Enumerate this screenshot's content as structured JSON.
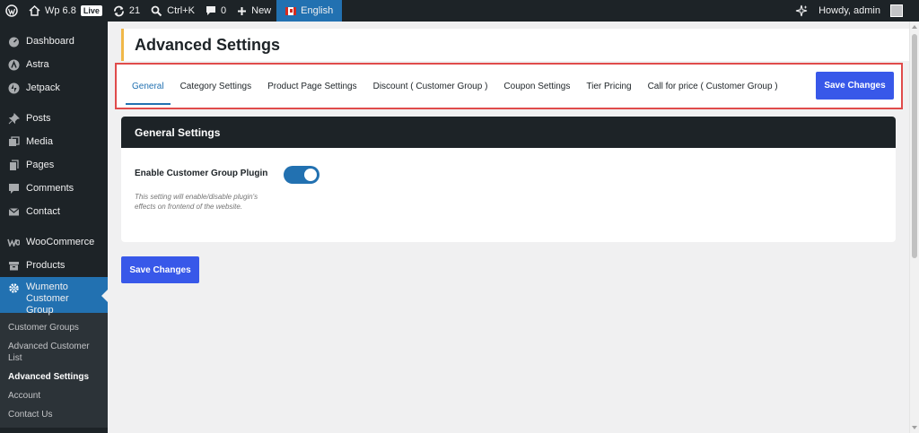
{
  "adminbar": {
    "site_name": "Wp 6.8",
    "live_label": "Live",
    "updates_count": "21",
    "search_shortcut": "Ctrl+K",
    "comments_count": "0",
    "new_label": "New",
    "language": "English",
    "greeting": "Howdy, admin"
  },
  "sidebar": {
    "items": [
      {
        "label": "Dashboard",
        "icon": "dashboard-icon"
      },
      {
        "label": "Astra",
        "icon": "astra-icon"
      },
      {
        "label": "Jetpack",
        "icon": "jetpack-icon"
      },
      {
        "label": "Posts",
        "icon": "pin-icon"
      },
      {
        "label": "Media",
        "icon": "media-icon"
      },
      {
        "label": "Pages",
        "icon": "pages-icon"
      },
      {
        "label": "Comments",
        "icon": "comment-icon"
      },
      {
        "label": "Contact",
        "icon": "mail-icon"
      },
      {
        "label": "WooCommerce",
        "icon": "woo-icon"
      },
      {
        "label": "Products",
        "icon": "archive-icon"
      },
      {
        "label": "Wumento Customer Group",
        "icon": "gear-icon"
      }
    ],
    "submenu": [
      "Customer Groups",
      "Advanced Customer List",
      "Advanced Settings",
      "Account",
      "Contact Us"
    ]
  },
  "page": {
    "title": "Advanced Settings",
    "tabs": [
      "General",
      "Category Settings",
      "Product Page Settings",
      "Discount ( Customer Group )",
      "Coupon Settings",
      "Tier Pricing",
      "Call for price ( Customer Group )"
    ],
    "save_label": "Save Changes"
  },
  "general": {
    "heading": "General Settings",
    "setting_label": "Enable Customer Group Plugin",
    "setting_desc": "This setting will enable/disable plugin's effects on frontend of the website.",
    "enabled": true
  },
  "colors": {
    "accent": "#2271b1",
    "button": "#3858e9",
    "highlight_border": "#e04b4b",
    "title_bar": "#f0b849"
  }
}
